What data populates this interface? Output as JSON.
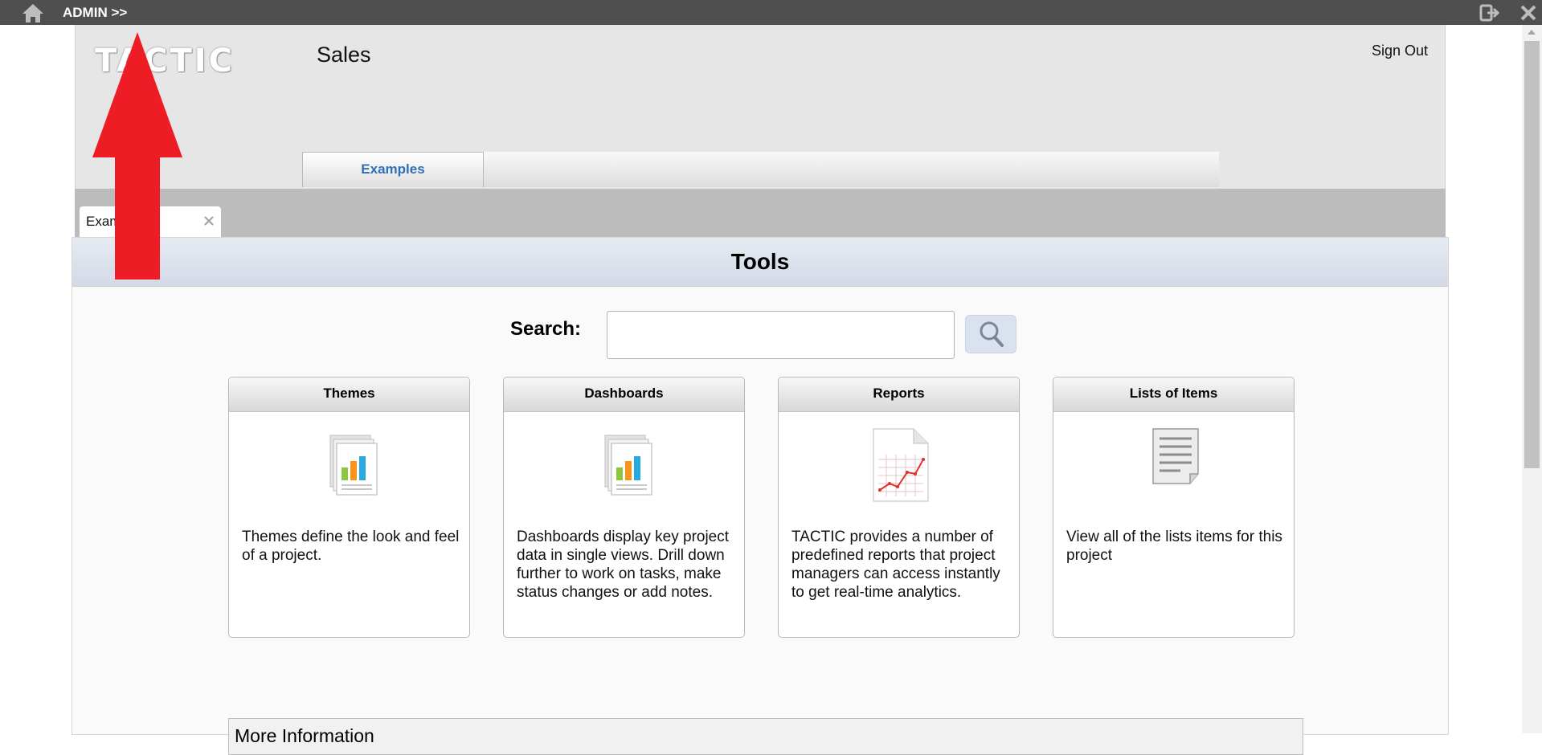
{
  "topbar": {
    "admin_label": "ADMIN >>",
    "home_icon": "home-icon",
    "logout_icon": "logout-icon",
    "close_icon": "close-icon"
  },
  "header": {
    "logo_text": "TACTIC",
    "project_title": "Sales",
    "signout_label": "Sign Out"
  },
  "nav": {
    "tabs": [
      {
        "label": "Examples"
      }
    ]
  },
  "doc_tabs": [
    {
      "label": "Exam"
    }
  ],
  "tools": {
    "title": "Tools",
    "search": {
      "label": "Search:",
      "value": "",
      "placeholder": ""
    },
    "cards": [
      {
        "title": "Themes",
        "icon": "chart-document-icon",
        "description": "Themes define the look and feel of a project."
      },
      {
        "title": "Dashboards",
        "icon": "chart-document-icon",
        "description": "Dashboards display key project data in single views. Drill down further to work on tasks, make status changes or add notes."
      },
      {
        "title": "Reports",
        "icon": "report-icon",
        "description": "TACTIC provides a number of predefined reports that project managers can access instantly to get real-time analytics."
      },
      {
        "title": "Lists of Items",
        "icon": "list-document-icon",
        "description": "View all of the lists items for this project"
      }
    ]
  },
  "more_info": {
    "title": "More Information"
  },
  "colors": {
    "accent_blue": "#2e6fb5",
    "topbar": "#4f4f4f",
    "annotation_red": "#ee1c25"
  }
}
